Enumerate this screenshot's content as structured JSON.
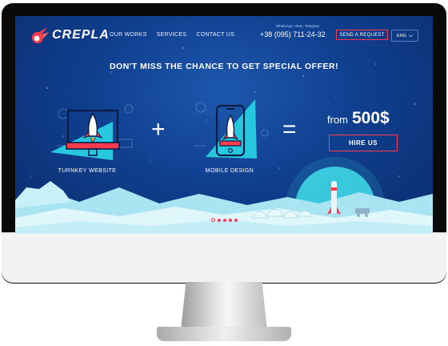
{
  "brand": {
    "name": "CREPLA"
  },
  "nav": {
    "items": [
      "OUR WORKS",
      "SERVICES",
      "CONTACT US"
    ]
  },
  "header": {
    "contact_note": "WhatsApp, Viber, Telegram",
    "phone": "+38 (095) 711-24-32",
    "send_request": "SEND A REQUEST",
    "language": "ENG"
  },
  "hero": {
    "headline": "DON'T MISS THE CHANCE TO GET SPECIAL OFFER!",
    "items": [
      {
        "caption": "TURNKEY WEBSITE",
        "icon": "rocket-monitor-icon"
      },
      {
        "caption": "MOBILE DESIGN",
        "icon": "rocket-phone-icon"
      }
    ],
    "plus": "+",
    "equals": "=",
    "price_from": "from",
    "price_value": "500$",
    "cta": "HIRE US"
  },
  "slider": {
    "total": 5,
    "active": 0
  },
  "colors": {
    "accent": "#ff3b4f",
    "cyan": "#27c7e0",
    "background": "#103f8f"
  }
}
